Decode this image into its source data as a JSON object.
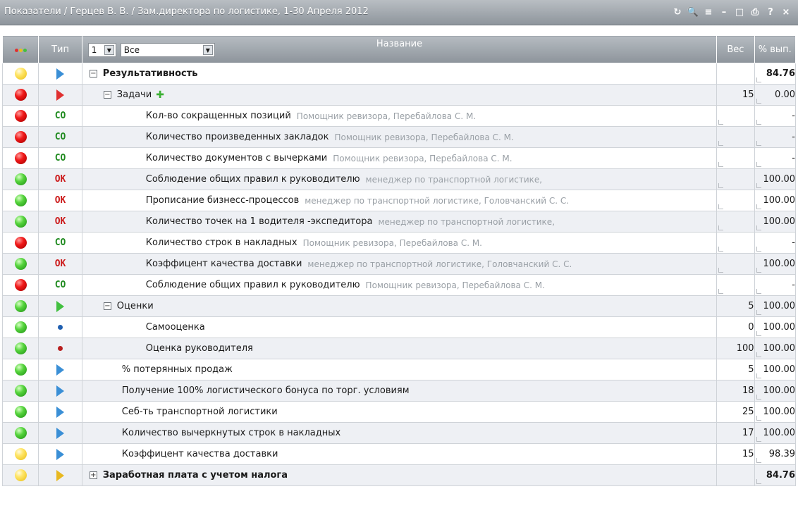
{
  "window": {
    "title": "Показатели / Герцев В. В. / Зам.директора по логистике, 1-30 Апреля 2012",
    "tools": [
      {
        "name": "refresh-icon",
        "glyph": "↻"
      },
      {
        "name": "search-icon",
        "glyph": "🔍"
      },
      {
        "name": "list-icon",
        "glyph": "≡"
      },
      {
        "name": "minimize-icon",
        "glyph": "–"
      },
      {
        "name": "maximize-icon",
        "glyph": "□"
      },
      {
        "name": "print-icon",
        "glyph": "⎙"
      },
      {
        "name": "help-icon",
        "glyph": "?"
      },
      {
        "name": "close-icon",
        "glyph": "×"
      }
    ]
  },
  "header": {
    "type_label": "Тип",
    "name_label": "Название",
    "ves_label": "Вес",
    "pct_label": "% вып.",
    "level_select": "1",
    "filter_select": "Все"
  },
  "rows": [
    {
      "status": "yellow",
      "type": "tri-blue",
      "level": 0,
      "toggle": "−",
      "name": "Результативность",
      "bold": true,
      "owner": "",
      "ves": "",
      "pct": "84.76",
      "pct_bold": true,
      "corner_ves": false,
      "corner_pct": true
    },
    {
      "status": "red",
      "type": "tri-red",
      "level": 1,
      "toggle": "−",
      "name": "Задачи",
      "bold": false,
      "plus": true,
      "owner": "",
      "ves": "15",
      "pct": "0.00",
      "corner_ves": false,
      "corner_pct": true
    },
    {
      "status": "red",
      "type": "co",
      "type_text": "CO",
      "level": 2,
      "name": "Кол-во сокращенных позиций",
      "owner": "Помощник ревизора, Перебайлова С. М.",
      "ves": "",
      "pct": "-",
      "corner_ves": true,
      "corner_pct": true
    },
    {
      "status": "red",
      "type": "co",
      "type_text": "CO",
      "level": 2,
      "name": "Количество произведенных закладок",
      "owner": "Помощник ревизора, Перебайлова С. М.",
      "ves": "",
      "pct": "-",
      "corner_ves": true,
      "corner_pct": true
    },
    {
      "status": "red",
      "type": "co",
      "type_text": "CO",
      "level": 2,
      "name": "Количество документов с вычерками",
      "owner": "Помощник ревизора, Перебайлова С. М.",
      "ves": "",
      "pct": "-",
      "corner_ves": true,
      "corner_pct": true
    },
    {
      "status": "green",
      "type": "ok",
      "type_text": "OK",
      "level": 2,
      "name": "Соблюдение общих правил к руководителю",
      "owner": "менеджер по транспортной логистике,",
      "ves": "",
      "pct": "100.00",
      "corner_ves": true,
      "corner_pct": true
    },
    {
      "status": "green",
      "type": "ok",
      "type_text": "OK",
      "level": 2,
      "name": "Прописание бизнесс-процессов",
      "owner": "менеджер по транспортной логистике, Головчанский С. С.",
      "ves": "",
      "pct": "100.00",
      "corner_ves": true,
      "corner_pct": true
    },
    {
      "status": "green",
      "type": "ok",
      "type_text": "OK",
      "level": 2,
      "name": "Количество точек на 1 водителя -экспедитора",
      "owner": "менеджер по транспортной логистике,",
      "ves": "",
      "pct": "100.00",
      "corner_ves": true,
      "corner_pct": true
    },
    {
      "status": "red",
      "type": "co",
      "type_text": "CO",
      "level": 2,
      "name": "Количество строк в накладных",
      "owner": "Помощник ревизора, Перебайлова С. М.",
      "ves": "",
      "pct": "-",
      "corner_ves": true,
      "corner_pct": true
    },
    {
      "status": "green",
      "type": "ok",
      "type_text": "OK",
      "level": 2,
      "name": "Коэффицент качества доставки",
      "owner": "менеджер по транспортной логистике, Головчанский С. С.",
      "ves": "",
      "pct": "100.00",
      "corner_ves": true,
      "corner_pct": true
    },
    {
      "status": "red",
      "type": "co",
      "type_text": "CO",
      "level": 2,
      "name": "Соблюдение общих правил к руководителю",
      "owner": "Помощник ревизора, Перебайлова С. М.",
      "ves": "",
      "pct": "-",
      "corner_ves": true,
      "corner_pct": true
    },
    {
      "status": "green",
      "type": "tri-green",
      "level": 1,
      "toggle": "−",
      "name": "Оценки",
      "owner": "",
      "ves": "5",
      "pct": "100.00",
      "corner_ves": false,
      "corner_pct": true
    },
    {
      "status": "green",
      "type": "dot-blue",
      "level": 2,
      "name": "Самооценка",
      "owner": "",
      "ves": "0",
      "pct": "100.00",
      "corner_ves": false,
      "corner_pct": true
    },
    {
      "status": "green",
      "type": "dot-red",
      "level": 2,
      "name": "Оценка руководителя",
      "owner": "",
      "ves": "100",
      "pct": "100.00",
      "corner_ves": false,
      "corner_pct": true
    },
    {
      "status": "green",
      "type": "tri-blue",
      "level": 1,
      "name": "% потерянных продаж",
      "owner": "",
      "ves": "5",
      "pct": "100.00",
      "corner_ves": false,
      "corner_pct": true
    },
    {
      "status": "green",
      "type": "tri-blue",
      "level": 1,
      "name": "Получение 100% логистического бонуса по торг. условиям",
      "owner": "",
      "ves": "18",
      "pct": "100.00",
      "corner_ves": false,
      "corner_pct": true
    },
    {
      "status": "green",
      "type": "tri-blue",
      "level": 1,
      "name": "Себ-ть транспортной логистики",
      "owner": "",
      "ves": "25",
      "pct": "100.00",
      "corner_ves": false,
      "corner_pct": true
    },
    {
      "status": "green",
      "type": "tri-blue",
      "level": 1,
      "name": "Количество вычеркнутых строк в накладных",
      "owner": "",
      "ves": "17",
      "pct": "100.00",
      "corner_ves": false,
      "corner_pct": true
    },
    {
      "status": "yellow",
      "type": "tri-blue",
      "level": 1,
      "name": "Коэффицент качества доставки",
      "owner": "",
      "ves": "15",
      "pct": "98.39",
      "corner_ves": false,
      "corner_pct": true
    },
    {
      "status": "yellow",
      "type": "tri-gold",
      "level": 0,
      "toggle": "+",
      "name": "Заработная плата с учетом налога",
      "bold": true,
      "owner": "",
      "ves": "",
      "pct": "84.76",
      "pct_bold": true,
      "corner_ves": false,
      "corner_pct": true
    }
  ]
}
